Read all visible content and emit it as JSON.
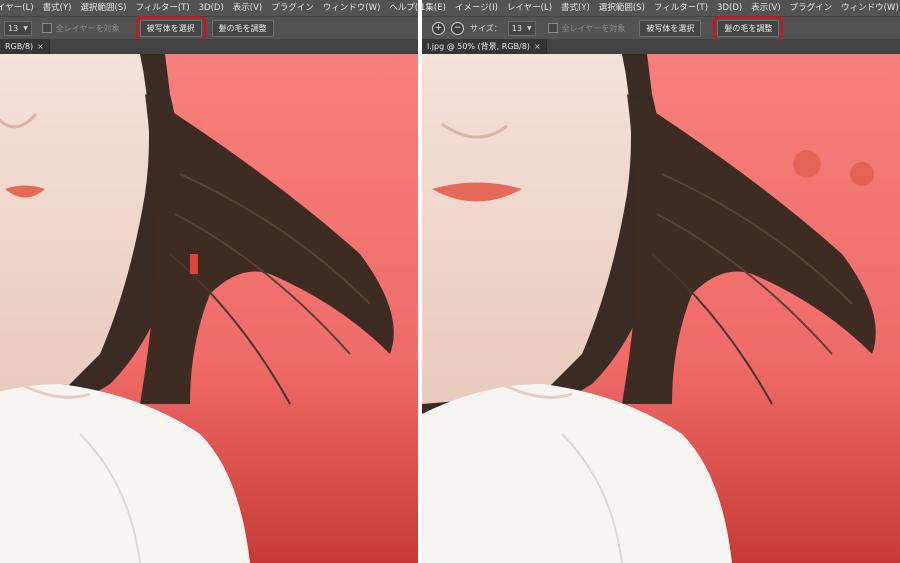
{
  "left_panel": {
    "menu": [
      "イヤー(L)",
      "書式(Y)",
      "選択範囲(S)",
      "フィルター(T)",
      "3D(D)",
      "表示(V)",
      "プラグイン",
      "ウィンドウ(W)",
      "ヘルプ(H)"
    ],
    "options": {
      "size_value": "13",
      "sample_all_layers_label": "全レイヤーを対象",
      "select_subject_label": "被写体を選択",
      "refine_hair_label": "髪の毛を調整",
      "highlighted": "select_subject"
    },
    "doc_tab": {
      "label": "RGB/8)",
      "close": "×"
    }
  },
  "right_panel": {
    "menu": [
      "1集(E)",
      "イメージ(I)",
      "レイヤー(L)",
      "書式(Y)",
      "選択範囲(S)",
      "フィルター(T)",
      "3D(D)",
      "表示(V)",
      "プラグイン",
      "ウィンドウ(W)",
      "ヘルプ(H)"
    ],
    "options": {
      "add_symbol": "+",
      "subtract_symbol": "−",
      "size_label": "サイズ：",
      "size_value": "13",
      "sample_all_layers_label": "全レイヤーを対象",
      "select_subject_label": "被写体を選択",
      "refine_hair_label": "髪の毛を調整",
      "highlighted": "refine_hair"
    },
    "doc_tab": {
      "label": "l.jpg @ 50% (背景, RGB/8)",
      "close": "×"
    }
  },
  "colors": {
    "highlight": "#e2081b",
    "overlay": "#f26d6b",
    "ui_background": "#535353"
  }
}
